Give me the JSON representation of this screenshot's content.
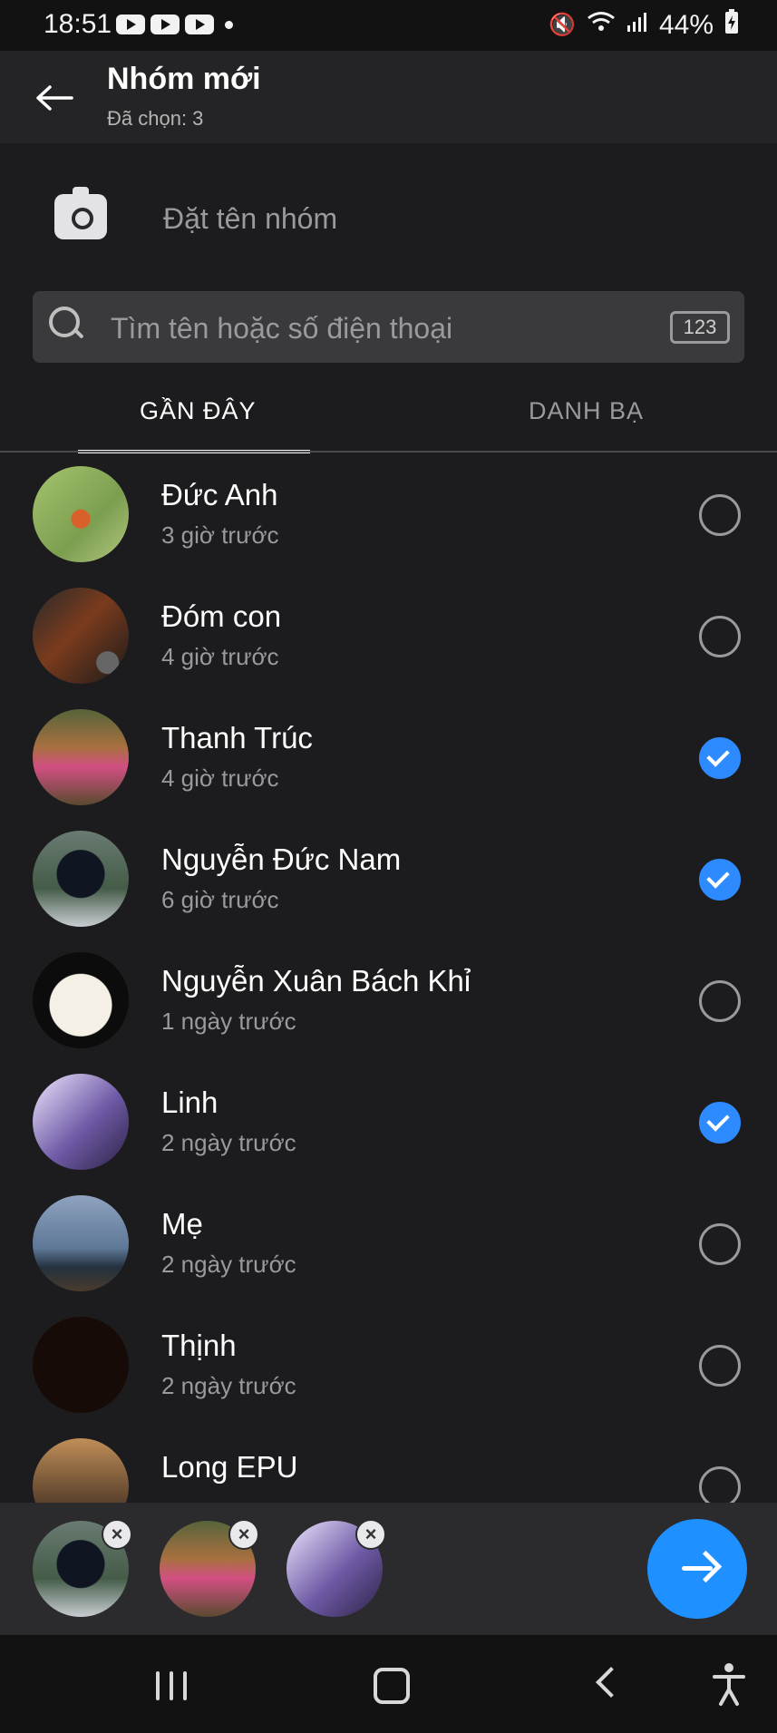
{
  "status_bar": {
    "time": "18:51",
    "battery": "44%"
  },
  "header": {
    "title": "Nhóm mới",
    "subtitle": "Đã chọn: 3"
  },
  "group_name": {
    "placeholder": "Đặt tên nhóm",
    "value": ""
  },
  "search": {
    "placeholder": "Tìm tên hoặc số điện thoại",
    "value": "",
    "keypad_label": "123"
  },
  "tabs": [
    {
      "label": "GẦN ĐÂY",
      "active": true
    },
    {
      "label": "DANH BẠ",
      "active": false
    }
  ],
  "contacts": [
    {
      "name": "Đức Anh",
      "time": "3 giờ trước",
      "selected": false
    },
    {
      "name": "Đóm con",
      "time": "4 giờ trước",
      "selected": false
    },
    {
      "name": "Thanh Trúc",
      "time": "4 giờ trước",
      "selected": true
    },
    {
      "name": "Nguyễn Đức Nam",
      "time": "6 giờ trước",
      "selected": true
    },
    {
      "name": "Nguyễn Xuân Bách Khỉ",
      "time": "1 ngày trước",
      "selected": false
    },
    {
      "name": "Linh",
      "time": "2 ngày trước",
      "selected": true
    },
    {
      "name": "Mẹ",
      "time": "2 ngày trước",
      "selected": false
    },
    {
      "name": "Thịnh",
      "time": "2 ngày trước",
      "selected": false
    },
    {
      "name": "Long EPU",
      "time": "",
      "selected": false
    }
  ],
  "selected_tray": [
    {
      "contact": "Nguyễn Đức Nam"
    },
    {
      "contact": "Thanh Trúc"
    },
    {
      "contact": "Linh"
    }
  ],
  "icons": {
    "back": "arrow-left-icon",
    "camera": "camera-icon",
    "search": "search-icon",
    "next": "arrow-right-icon",
    "remove": "close-icon"
  },
  "colors": {
    "accent": "#1e90ff",
    "background": "#1c1c1e"
  }
}
